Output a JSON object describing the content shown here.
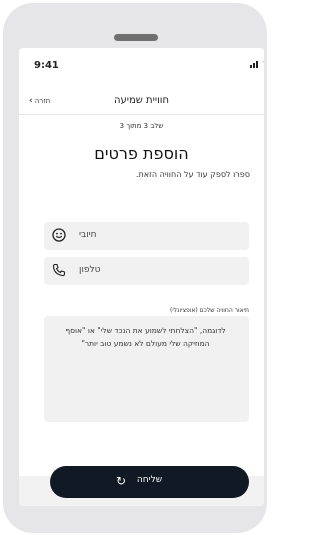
{
  "status_bar": {
    "time": "9:41"
  },
  "nav": {
    "title": "חוויית שמיעה",
    "back_label": "חזרה"
  },
  "step": "שלב 3 מתוך 3",
  "title": "הוספת פרטים",
  "subtitle": "ספרו לספק עוד על החוויה הזאת.",
  "fields": [
    {
      "icon": "smiley-icon",
      "placeholder": "חיובי"
    },
    {
      "icon": "phone-icon",
      "placeholder": "טלפון"
    }
  ],
  "description": {
    "label": "תיאור החוויה שלכם (אופציונלי)",
    "placeholder": "לדוגמה, \"הצלחתי לשמוע את הנכד שלי\" או \"אוסף המוזיקה שלי מעולם לא נשמע טוב יותר\""
  },
  "send_button": {
    "label": "שליחה"
  }
}
